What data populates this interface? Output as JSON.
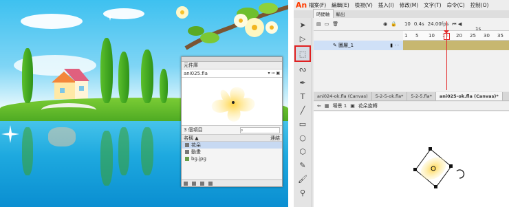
{
  "menubar": {
    "logo": "An",
    "items": [
      "檔案(F)",
      "編輯(E)",
      "檢視(V)",
      "插入(I)",
      "修改(M)",
      "文字(T)",
      "命令(C)",
      "控制(O)"
    ]
  },
  "panel_tabs": [
    "時間軸",
    "輸出"
  ],
  "timeline": {
    "frame": "10",
    "fps_value": "0.4",
    "fps_unit": "s",
    "fps": "24.00",
    "fps_label": "fps",
    "ruler_ticks": [
      "1",
      "5",
      "10",
      "15",
      "20",
      "25",
      "30",
      "35"
    ],
    "ruler_extra": "1s",
    "layer_name": "圖層_1"
  },
  "document_tabs": [
    "ani024-ok.fla (Canvas)",
    "5-2-5-ok.fla*",
    "5-2-5.fla*",
    "ani025-ok.fla (Canvas)*"
  ],
  "breadcrumb": {
    "scene": "場景 1",
    "symbol": "花朵旋轉"
  },
  "library": {
    "title": "元件庫",
    "file": "ani025.fla",
    "count": "3 個項目",
    "col_name": "名稱 ▲",
    "col_link": "連結",
    "items": [
      "花朵",
      "動畫",
      "bg.jpg"
    ]
  },
  "colors": {
    "accent_red": "#e02020",
    "frames": "#c7b770",
    "selection": "#cfe0f7"
  },
  "icons": [
    "selection-tool-icon",
    "subselection-tool-icon",
    "free-transform-tool-icon",
    "lasso-icon",
    "pen-icon",
    "text-icon",
    "line-icon",
    "rectangle-icon",
    "oval-icon",
    "polystar-icon",
    "pencil-icon",
    "brush-icon",
    "paint-brush-icon",
    "bone-icon",
    "eyedropper-icon"
  ]
}
